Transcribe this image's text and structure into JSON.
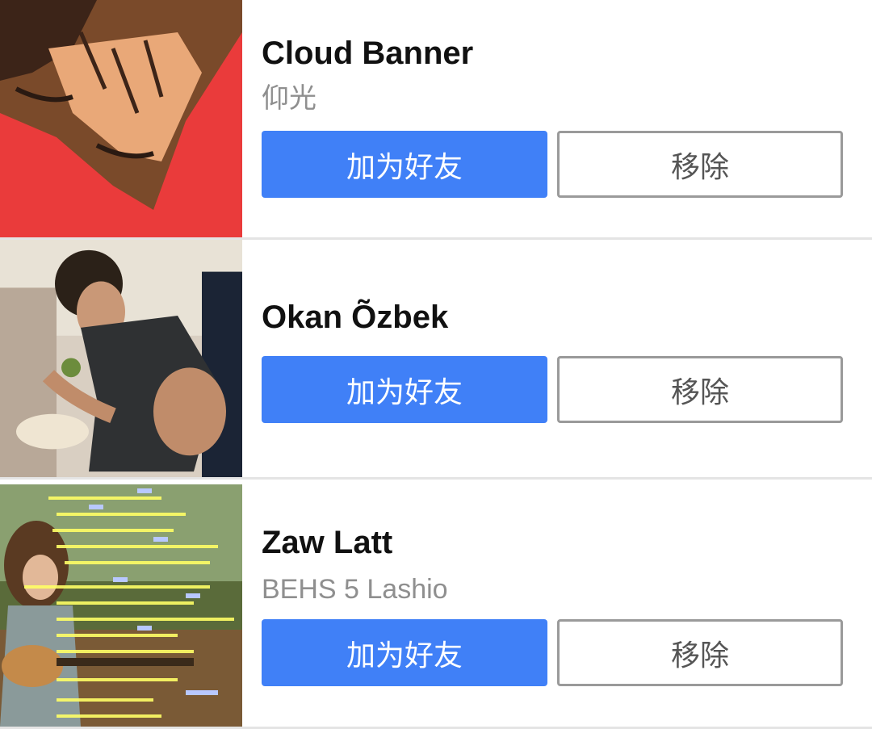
{
  "friend_suggestions": [
    {
      "name": "Cloud Banner",
      "subtitle": "仰光",
      "add_label": "加为好友",
      "remove_label": "移除",
      "avatar_icon": "avatar-red-illustration"
    },
    {
      "name": "Okan Õzbek",
      "subtitle": "",
      "add_label": "加为好友",
      "remove_label": "移除",
      "avatar_icon": "avatar-man-photo"
    },
    {
      "name": "Zaw Latt",
      "subtitle": "BEHS 5 Lashio",
      "add_label": "加为好友",
      "remove_label": "移除",
      "avatar_icon": "avatar-guitar-chords"
    }
  ],
  "colors": {
    "add_button": "#4080f7",
    "remove_border": "#9a9a9a",
    "subtitle_text": "#8f8f8f",
    "divider": "#e4e4e4"
  }
}
